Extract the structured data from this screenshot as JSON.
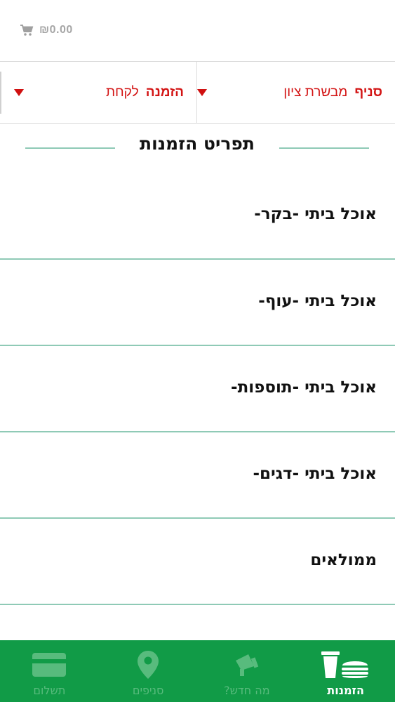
{
  "header": {
    "cart_amount": "₪0.00",
    "icons": {
      "cart": "cart-icon"
    }
  },
  "filters": {
    "branch": {
      "label": "סניף",
      "value": "מבשרת ציון"
    },
    "order_type": {
      "label": "הזמנה",
      "value": "לקחת"
    }
  },
  "menu": {
    "title": "תפריט הזמנות",
    "items": [
      {
        "label": "אוכל ביתי -בקר-"
      },
      {
        "label": "אוכל ביתי -עוף-"
      },
      {
        "label": "אוכל ביתי -תוספות-"
      },
      {
        "label": "אוכל ביתי -דגים-"
      },
      {
        "label": "ממולאים"
      }
    ]
  },
  "bottom_nav": {
    "tabs": [
      {
        "label": "תשלום",
        "icon": "credit-card-icon",
        "active": false
      },
      {
        "label": "סניפים",
        "icon": "location-pin-icon",
        "active": false
      },
      {
        "label": "מה חדש?",
        "icon": "megaphone-icon",
        "active": false
      },
      {
        "label": "הזמנות",
        "icon": "cup-burger-icon",
        "active": true
      }
    ]
  },
  "colors": {
    "accent_red": "#d31515",
    "nav_green": "#119b47",
    "divider_green": "#8fcab6",
    "inactive_tab": "#58bb7d"
  }
}
